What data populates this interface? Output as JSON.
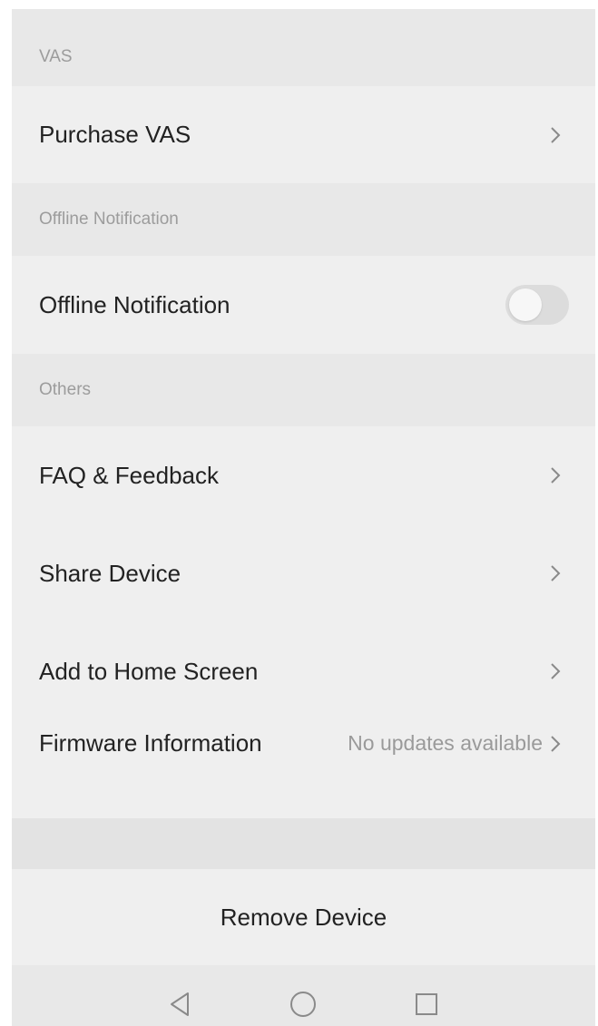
{
  "sections": {
    "vas": {
      "header": "VAS",
      "items": [
        {
          "label": "Purchase VAS",
          "icon": "chevron-right-icon"
        }
      ]
    },
    "offline": {
      "header": "Offline Notification",
      "items": [
        {
          "label": "Offline Notification",
          "toggle_on": false
        }
      ]
    },
    "others": {
      "header": "Others",
      "items": [
        {
          "label": "FAQ & Feedback",
          "icon": "chevron-right-icon"
        },
        {
          "label": "Share Device",
          "icon": "chevron-right-icon"
        },
        {
          "label": "Add to Home Screen",
          "icon": "chevron-right-icon"
        },
        {
          "label": "Firmware Information",
          "status": "No updates available",
          "icon": "chevron-right-icon"
        }
      ]
    }
  },
  "remove_device": {
    "label": "Remove Device"
  },
  "nav_bar": {
    "icons": [
      "back-triangle-icon",
      "home-circle-icon",
      "recents-square-icon"
    ]
  },
  "colors": {
    "background": "#e8e8e8",
    "row_background": "#efefef",
    "primary_text": "#222222",
    "secondary_text": "#9c9c9c",
    "toggle_off": "#dcdcdc"
  }
}
